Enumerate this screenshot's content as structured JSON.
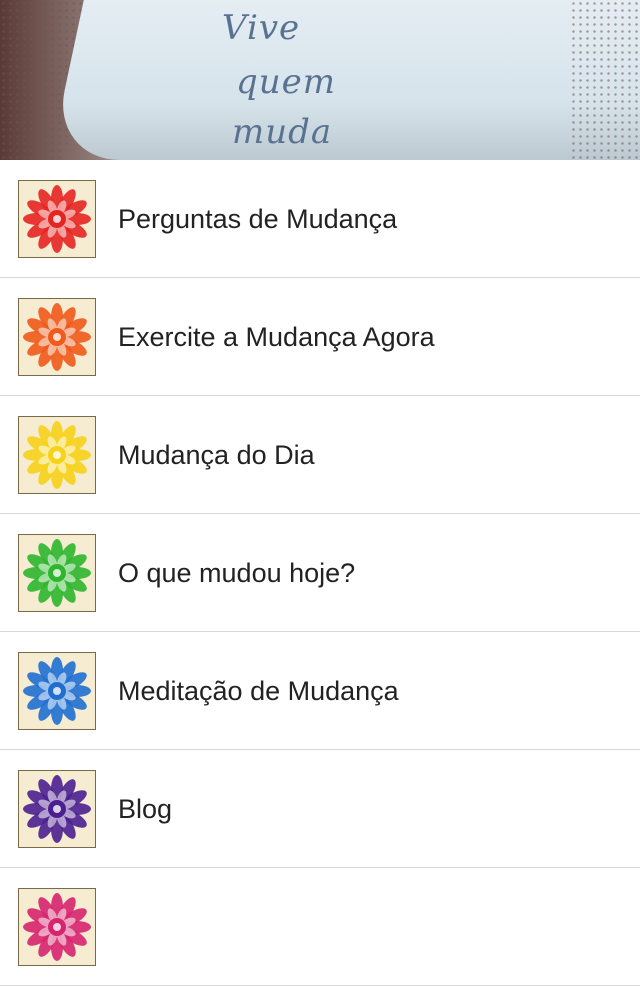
{
  "header": {
    "handwriting": [
      "Vive",
      "quem",
      "muda"
    ]
  },
  "menu": {
    "items": [
      {
        "label": "Perguntas de Mudança",
        "icon": "red-mandala-icon",
        "color": "#e52521"
      },
      {
        "label": "Exercite a Mudança Agora",
        "icon": "orange-mandala-icon",
        "color": "#f05a1a"
      },
      {
        "label": "Mudança do Dia",
        "icon": "yellow-mandala-icon",
        "color": "#f7d21a"
      },
      {
        "label": "O que mudou hoje?",
        "icon": "green-mandala-icon",
        "color": "#2eb62c"
      },
      {
        "label": "Meditação de Mudança",
        "icon": "blue-mandala-icon",
        "color": "#1f6fd1"
      },
      {
        "label": "Blog",
        "icon": "purple-mandala-icon",
        "color": "#4b1f8f"
      },
      {
        "label": "",
        "icon": "pink-mandala-icon",
        "color": "#d6246e"
      }
    ]
  }
}
